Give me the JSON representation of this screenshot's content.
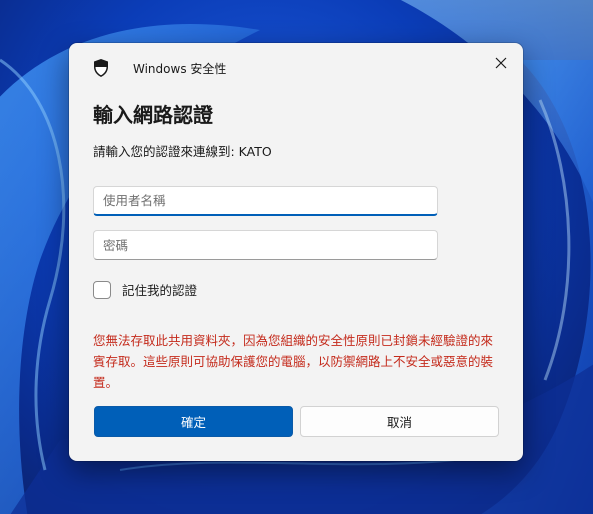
{
  "dialog": {
    "app_title": "Windows 安全性",
    "heading": "輸入網路認證",
    "subtext": "請輸入您的認證來連線到: KATO",
    "username_placeholder": "使用者名稱",
    "password_placeholder": "密碼",
    "remember_label": "記住我的認證",
    "error_message": "您無法存取此共用資料夾，因為您組織的安全性原則已封鎖未經驗證的來賓存取。這些原則可協助保護您的電腦，以防禦網路上不安全或惡意的裝置。",
    "ok_label": "確定",
    "cancel_label": "取消"
  },
  "icons": {
    "app": "shield-icon",
    "close": "close-icon"
  },
  "colors": {
    "accent": "#005fb8",
    "error": "#c42b1c",
    "dialog_bg": "#f3f3f3"
  }
}
